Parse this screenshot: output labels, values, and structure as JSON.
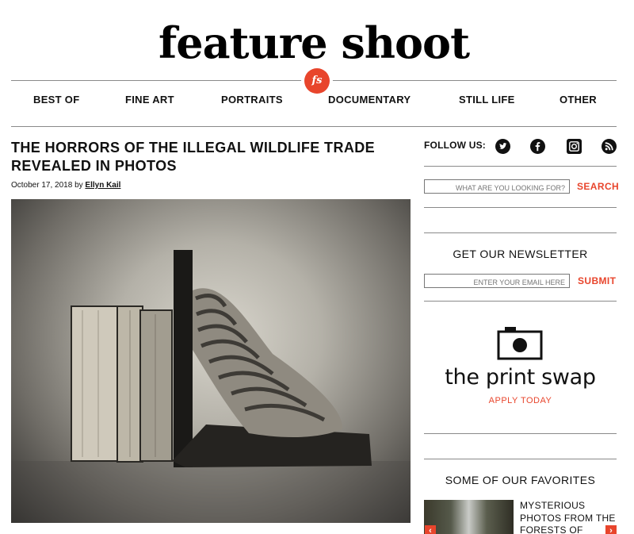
{
  "site": {
    "logo_text": "feature shoot",
    "badge_text": "fs"
  },
  "nav": {
    "items": [
      "BEST OF",
      "FINE ART",
      "PORTRAITS",
      "DOCUMENTARY",
      "STILL LIFE",
      "OTHER"
    ]
  },
  "article": {
    "title": "THE HORRORS OF THE ILLEGAL WILDLIFE TRADE REVEALED IN PHOTOS",
    "date": "October 17, 2018",
    "by": "by",
    "author": "Ellyn Kail"
  },
  "sidebar": {
    "follow_label": "FOLLOW US:",
    "social_icons": [
      "twitter-icon",
      "facebook-icon",
      "instagram-icon",
      "rss-icon"
    ],
    "search": {
      "placeholder": "WHAT ARE YOU LOOKING FOR?",
      "button": "SEARCH"
    },
    "newsletter": {
      "heading": "GET OUR NEWSLETTER",
      "placeholder": "ENTER YOUR EMAIL HERE",
      "button": "SUBMIT"
    },
    "print_swap": {
      "title": "the print swap",
      "cta": "APPLY TODAY"
    },
    "favorites": {
      "heading": "SOME OF OUR FAVORITES",
      "item_title": "MYSTERIOUS PHOTOS FROM THE FORESTS OF"
    }
  },
  "colors": {
    "accent": "#e8452c",
    "text": "#111111",
    "rule": "#8a8a8a"
  }
}
